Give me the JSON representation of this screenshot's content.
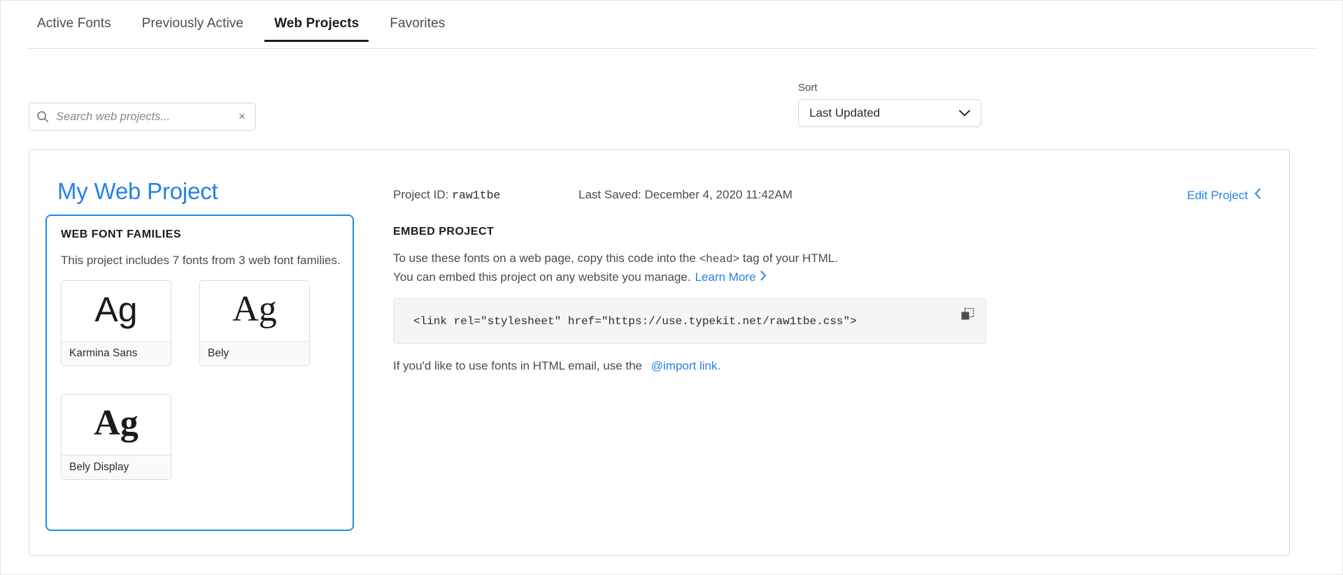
{
  "tabs": [
    {
      "label": "Active Fonts",
      "active": false
    },
    {
      "label": "Previously Active",
      "active": false
    },
    {
      "label": "Web Projects",
      "active": true
    },
    {
      "label": "Favorites",
      "active": false
    }
  ],
  "search": {
    "placeholder": "Search web projects...",
    "value": "",
    "clear_label": "×"
  },
  "sort": {
    "label": "Sort",
    "selected": "Last Updated"
  },
  "project": {
    "name": "My Web Project",
    "id_label": "Project ID:",
    "id_value": "raw1tbe",
    "last_saved": "Last Saved: December 4, 2020 11:42AM",
    "edit_label": "Edit Project"
  },
  "families": {
    "title": "WEB FONT FAMILIES",
    "summary": "This project includes 7 fonts from 3 web font families.",
    "font_count": 7,
    "family_count": 3,
    "specimen_text": "Ag",
    "items": [
      {
        "name": "Karmina Sans",
        "style": "sans"
      },
      {
        "name": "Bely",
        "style": "serif"
      },
      {
        "name": "Bely Display",
        "style": "serif-bold"
      }
    ]
  },
  "embed": {
    "title": "EMBED PROJECT",
    "line1_before": "To use these fonts on a web page, copy this code into the ",
    "line1_code": "<head>",
    "line1_after": " tag of your HTML.",
    "line2": "You can embed this project on any website you manage.",
    "learn_more": "Learn More",
    "code": "<link rel=\"stylesheet\" href=\"https://use.typekit.net/raw1tbe.css\">",
    "email_text": "If you'd like to use fonts in HTML email, use the",
    "import_link": "@import link."
  },
  "colors": {
    "accent_blue": "#2680eb",
    "highlight_border": "#1a8bf0",
    "text_primary": "#1b1b1b",
    "text_secondary": "#4b4b4b",
    "code_bg": "#f5f5f5"
  }
}
